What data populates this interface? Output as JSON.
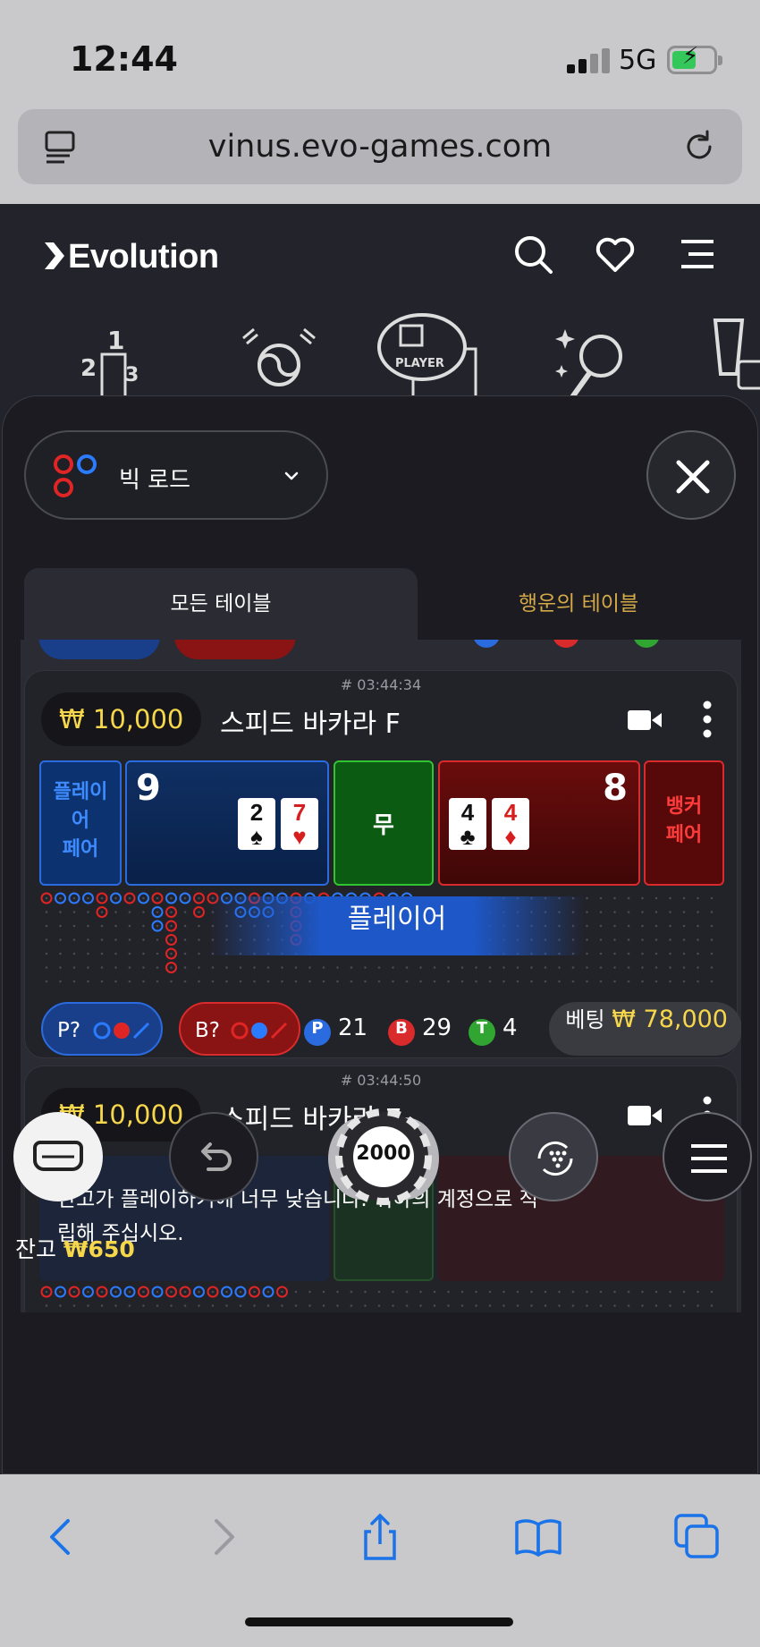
{
  "status_bar": {
    "time": "12:44",
    "network": "5G"
  },
  "browser": {
    "url": "vinus.evo-games.com"
  },
  "site": {
    "brand": "Evolution"
  },
  "filter": {
    "selected": "빅 로드"
  },
  "tabs": [
    {
      "label": "모든 테이블"
    },
    {
      "label": "행운의 테이블"
    }
  ],
  "tables": [
    {
      "round": "# 03:44:34",
      "min_bet": "₩ 10,000",
      "name": "스피드 바카라 F",
      "player_pair_label": "플레이\n어\n페어",
      "player_score": "9",
      "player_cards": [
        {
          "rank": "2",
          "suit": "♠",
          "color": "black"
        },
        {
          "rank": "7",
          "suit": "♥",
          "color": "red"
        }
      ],
      "tie_label": "무",
      "banker_score": "8",
      "banker_cards": [
        {
          "rank": "4",
          "suit": "♣",
          "color": "black"
        },
        {
          "rank": "4",
          "suit": "♦",
          "color": "red"
        }
      ],
      "banker_pair_label": "뱅커\n페어",
      "result_banner": "플레이어",
      "player_predict": "P?",
      "banker_predict": "B?",
      "player_count": "21",
      "banker_count": "29",
      "tie_count": "4",
      "player_badge": "P",
      "banker_badge": "B",
      "tie_badge": "T",
      "bet_label": "베팅",
      "bet_amount": "₩ 78,000"
    },
    {
      "round": "# 03:44:50",
      "min_bet": "₩ 10,000",
      "name": "스피드 바카라 7",
      "message": "잔고가 플레이하기에 너무 낮습니다. 귀하의 계정으로 적립해 주십시오."
    }
  ],
  "controls": {
    "chip_value": "2000"
  },
  "balance": {
    "label": "잔고",
    "amount": "₩650"
  },
  "colors": {
    "player": "#2a6be0",
    "banker": "#d92b2b",
    "tie": "#31c331",
    "gold": "#f6d74c"
  }
}
